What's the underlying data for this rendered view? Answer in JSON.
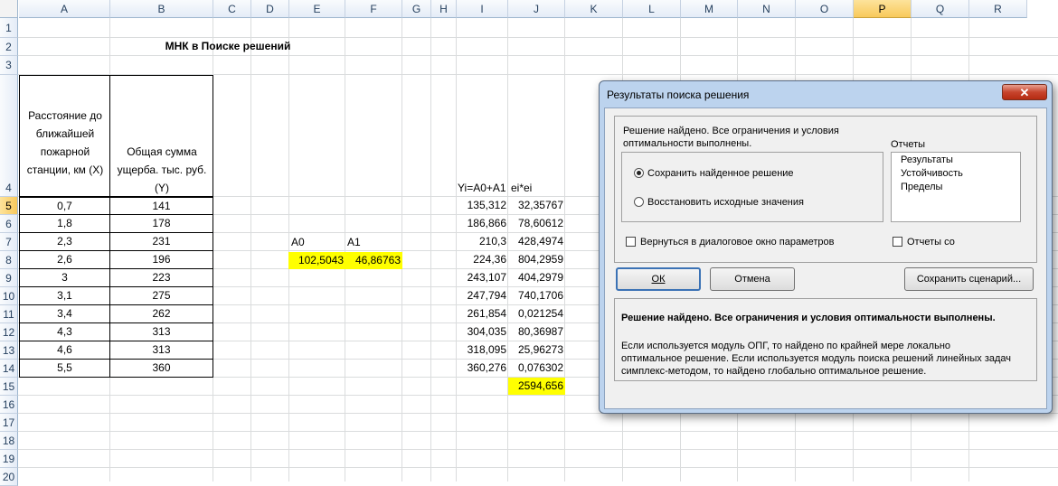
{
  "columns": [
    "A",
    "B",
    "C",
    "D",
    "E",
    "F",
    "G",
    "H",
    "I",
    "J",
    "K",
    "L",
    "M",
    "N",
    "O",
    "P",
    "Q",
    "R"
  ],
  "rows": [
    "1",
    "2",
    "3",
    "4",
    "5",
    "6",
    "7",
    "8",
    "9",
    "10",
    "11",
    "12",
    "13",
    "14",
    "15",
    "16",
    "17",
    "18",
    "19",
    "20"
  ],
  "sheet": {
    "title": "МНК в Поиске решений",
    "header_a": "Расстояние до ближайшей пожарной станции, км (X)",
    "header_b": "Общая сумма ущерба. тыс. руб. (Y)",
    "header_i": "Yi=A0+A1",
    "header_j": "ei*ei",
    "label_a0": "A0",
    "label_a1": "A1",
    "value_a0": "102,5043",
    "value_a1": "46,86763",
    "total": "2594,656",
    "data": [
      {
        "x": "0,7",
        "y": "141",
        "yi": "135,312",
        "e2": "32,35767"
      },
      {
        "x": "1,8",
        "y": "178",
        "yi": "186,866",
        "e2": "78,60612"
      },
      {
        "x": "2,3",
        "y": "231",
        "yi": "210,3",
        "e2": "428,4974"
      },
      {
        "x": "2,6",
        "y": "196",
        "yi": "224,36",
        "e2": "804,2959"
      },
      {
        "x": "3",
        "y": "223",
        "yi": "243,107",
        "e2": "404,2979"
      },
      {
        "x": "3,1",
        "y": "275",
        "yi": "247,794",
        "e2": "740,1706"
      },
      {
        "x": "3,4",
        "y": "262",
        "yi": "261,854",
        "e2": "0,021254"
      },
      {
        "x": "4,3",
        "y": "313",
        "yi": "304,035",
        "e2": "80,36987"
      },
      {
        "x": "4,6",
        "y": "313",
        "yi": "318,095",
        "e2": "25,96273"
      },
      {
        "x": "5,5",
        "y": "360",
        "yi": "360,276",
        "e2": "0,076302"
      }
    ]
  },
  "dialog": {
    "title": "Результаты поиска решения",
    "close_icon": "close-icon",
    "message_line1": "Решение найдено. Все ограничения и условия",
    "message_line2": "оптимальности выполнены.",
    "reports_label": "Отчеты",
    "reports": [
      "Результаты",
      "Устойчивость",
      "Пределы"
    ],
    "radio_keep": "Сохранить найденное решение",
    "radio_restore": "Восстановить исходные значения",
    "checkbox_return": "Вернуться в диалоговое окно параметров",
    "checkbox_reports": "Отчеты со",
    "ok_label": "ОК",
    "cancel_label": "Отмена",
    "save_scenario_label": "Сохранить сценарий...",
    "summary_bold": "Решение найдено. Все ограничения и условия оптимальности выполнены.",
    "summary_line1": "Если используется модуль ОПГ, то найдено по крайней мере локально",
    "summary_line2": "оптимальное решение. Если используется модуль поиска решений линейных задач",
    "summary_line3": "симплекс-методом, то найдено глобально оптимальное решение."
  },
  "colors": {
    "highlight": "#ffff00",
    "selected_header": "#f8c95b",
    "dialog_frame": "#bcd3ee"
  }
}
